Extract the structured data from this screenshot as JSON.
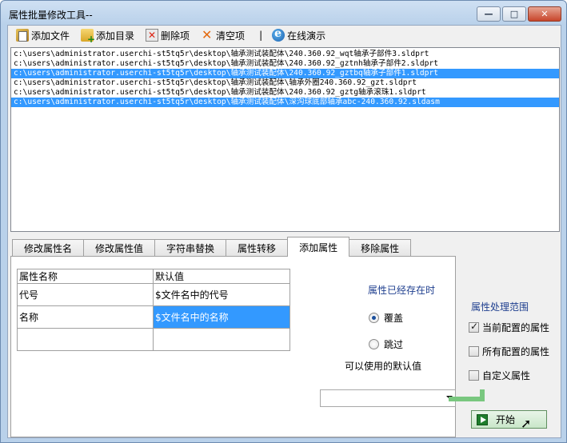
{
  "window": {
    "title": "属性批量修改工具--",
    "btn_min": "—",
    "btn_max": "□",
    "btn_close": "✕"
  },
  "toolbar": {
    "add_file": "添加文件",
    "add_dir": "添加目录",
    "delete_item": "删除项",
    "clear_items": "清空项",
    "separator": "|",
    "online_demo": "在线演示"
  },
  "files": [
    {
      "path": "c:\\users\\administrator.userchi-st5tq5r\\desktop\\轴承测试装配体\\240.360.92_wqt轴承子部件3.sldprt",
      "selected": false
    },
    {
      "path": "c:\\users\\administrator.userchi-st5tq5r\\desktop\\轴承测试装配体\\240.360.92_gztnh轴承子部件2.sldprt",
      "selected": false
    },
    {
      "path": "c:\\users\\administrator.userchi-st5tq5r\\desktop\\轴承测试装配体\\240.360.92_gztbq轴承子部件1.sldprt",
      "selected": true
    },
    {
      "path": "c:\\users\\administrator.userchi-st5tq5r\\desktop\\轴承测试装配体\\轴承外圈240.360.92_gzt.sldprt",
      "selected": false
    },
    {
      "path": "c:\\users\\administrator.userchi-st5tq5r\\desktop\\轴承测试装配体\\240.360.92_gztg轴承滚珠1.sldprt",
      "selected": false
    },
    {
      "path": "c:\\users\\administrator.userchi-st5tq5r\\desktop\\轴承测试装配体\\深沟球底部轴承abc-240.360.92.sldasm",
      "selected": true
    }
  ],
  "tabs": [
    {
      "label": "修改属性名",
      "active": false
    },
    {
      "label": "修改属性值",
      "active": false
    },
    {
      "label": "字符串替换",
      "active": false
    },
    {
      "label": "属性转移",
      "active": false
    },
    {
      "label": "添加属性",
      "active": true
    },
    {
      "label": "移除属性",
      "active": false
    }
  ],
  "grid": {
    "col_name": "属性名称",
    "col_default": "默认值",
    "rows": [
      {
        "name": "代号",
        "value": "$文件名中的代号",
        "selected": false
      },
      {
        "name": "名称",
        "value": "$文件名中的名称",
        "selected": true
      },
      {
        "name": "",
        "value": "",
        "selected": false
      }
    ]
  },
  "exists": {
    "label": "属性已经存在时",
    "overwrite": "覆盖",
    "skip": "跳过",
    "selected": "overwrite"
  },
  "defaults_label": "可以使用的默认值",
  "combo_value": "",
  "scope": {
    "label": "属性处理范围",
    "current_config": "当前配置的属性",
    "all_configs": "所有配置的属性",
    "custom": "自定义属性",
    "current_checked": true,
    "all_checked": false,
    "custom_checked": false
  },
  "start_button": "开始",
  "colors": {
    "selection": "#3399ff",
    "group_label": "#1f3f8f",
    "start_green": "#1e7d2c"
  }
}
